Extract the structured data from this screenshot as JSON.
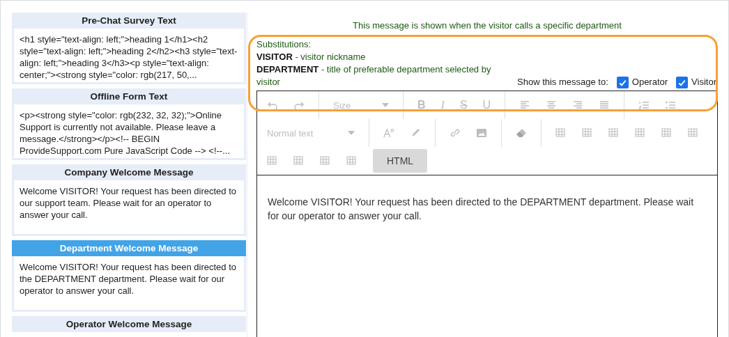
{
  "cards": [
    {
      "title": "Pre-Chat Survey Text",
      "text": "<h1 style=\"text-align: left;\">heading 1</h1><h2 style=\"text-align: left;\">heading 2</h2><h3 style=\"text-align: left;\">heading 3</h3><p style=\"text-align: center;\"><strong style=\"color: rgb(217, 50,...",
      "selected": false
    },
    {
      "title": "Offline Form Text",
      "text": "<p><strong style=\"color: rgb(232, 32, 32);\">Online Support is currently not available. Please leave a message.</strong></p><!-- BEGIN ProvideSupport.com Pure JavaScript Code --> <!--...",
      "selected": false
    },
    {
      "title": "Company Welcome Message",
      "text": "Welcome VISITOR! Your request has been directed to our support team. Please wait for an operator to answer your call.",
      "selected": false
    },
    {
      "title": "Department Welcome Message",
      "text": "Welcome VISITOR! Your request has been directed to the DEPARTMENT department. Please wait for our operator to answer your call.",
      "selected": true
    },
    {
      "title": "Operator Welcome Message",
      "selected": false
    }
  ],
  "description": "This message is shown when the visitor calls a specific department",
  "substitutions": {
    "heading": "Substitutions:",
    "items": [
      {
        "name": "VISITOR",
        "meaning": " - visitor nickname"
      },
      {
        "name": "DEPARTMENT",
        "meaning": " - title of preferable department selected by visitor"
      }
    ]
  },
  "show_to": {
    "label": "Show this message to:",
    "options": [
      {
        "label": "Operator",
        "checked": true
      },
      {
        "label": "Visitor",
        "checked": true
      }
    ]
  },
  "toolbar": {
    "disabled": true,
    "size_dropdown": "Size",
    "letters": [
      "B",
      "I",
      "S",
      "U"
    ],
    "format_dropdown": "Normal text",
    "html_button": {
      "label": "HTML",
      "selected": true
    }
  },
  "editor_text": "Welcome VISITOR! Your request has been directed to the DEPARTMENT department. Please wait for our operator to answer your call.",
  "highlight": true
}
